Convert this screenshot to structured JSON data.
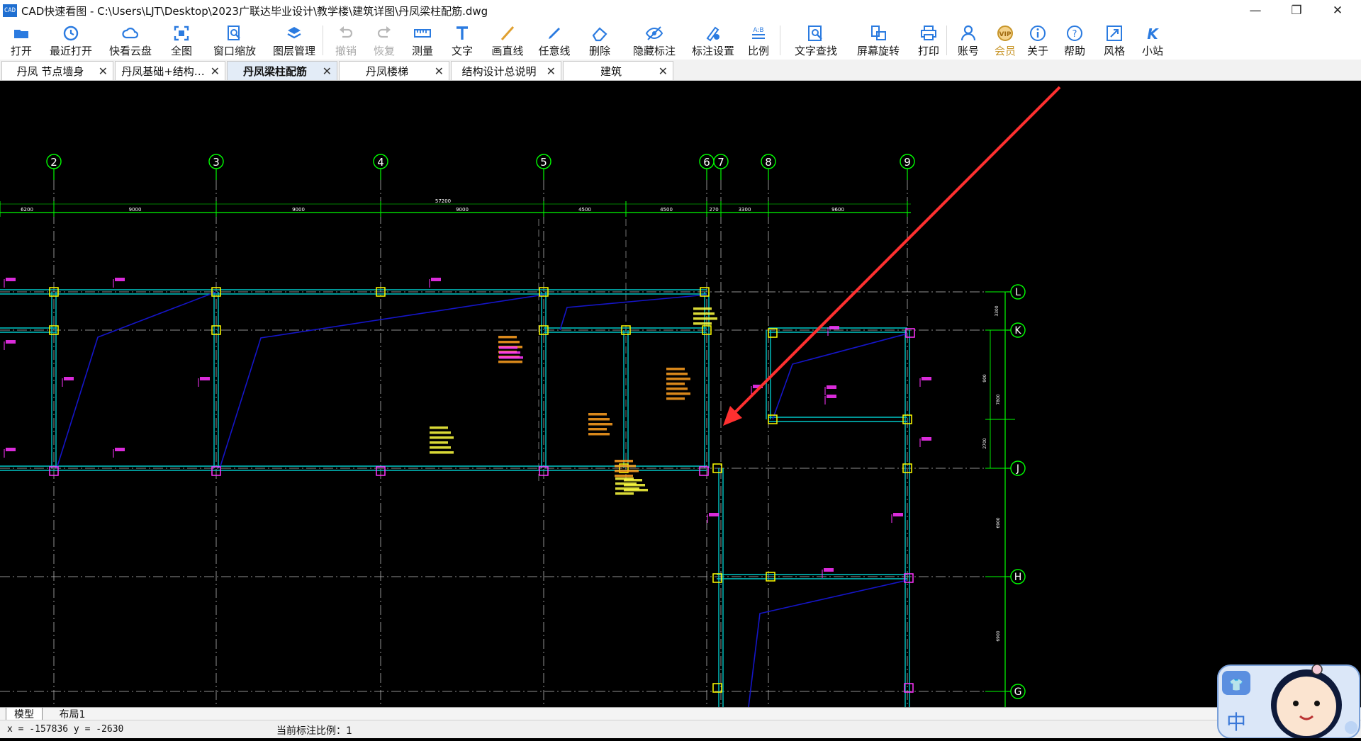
{
  "window": {
    "title": "CAD快速看图 - C:\\Users\\LJT\\Desktop\\2023广联达毕业设计\\教学楼\\建筑详图\\丹凤梁柱配筋.dwg",
    "icon_text": "CAD",
    "controls": {
      "minimize": "—",
      "restore": "❐",
      "close": "✕"
    }
  },
  "toolbar": {
    "items": [
      {
        "label": "打开",
        "icon": "folder-open-icon"
      },
      {
        "label": "最近打开",
        "icon": "history-icon"
      },
      {
        "label": "快看云盘",
        "icon": "cloud-icon"
      },
      {
        "label": "全图",
        "icon": "fullscreen-icon"
      },
      {
        "label": "窗口缩放",
        "icon": "zoom-window-icon"
      },
      {
        "label": "图层管理",
        "icon": "layers-icon"
      },
      {
        "label": "撤销",
        "icon": "undo-icon",
        "disabled": true
      },
      {
        "label": "恢复",
        "icon": "redo-icon",
        "disabled": true
      },
      {
        "label": "测量",
        "icon": "ruler-icon"
      },
      {
        "label": "文字",
        "icon": "text-icon"
      },
      {
        "label": "画直线",
        "icon": "line-icon"
      },
      {
        "label": "任意线",
        "icon": "pencil-icon"
      },
      {
        "label": "删除",
        "icon": "eraser-icon"
      },
      {
        "label": "隐藏标注",
        "icon": "eye-icon"
      },
      {
        "label": "标注设置",
        "icon": "annotation-settings-icon"
      },
      {
        "label": "比例",
        "icon": "scale-icon"
      },
      {
        "label": "文字查找",
        "icon": "text-search-icon"
      },
      {
        "label": "屏幕旋转",
        "icon": "rotate-screen-icon"
      },
      {
        "label": "打印",
        "icon": "printer-icon"
      },
      {
        "label": "账号",
        "icon": "user-icon"
      },
      {
        "label": "会员",
        "icon": "vip-icon",
        "vip": true
      },
      {
        "label": "关于",
        "icon": "info-icon"
      },
      {
        "label": "帮助",
        "icon": "help-icon"
      },
      {
        "label": "风格",
        "icon": "style-icon"
      },
      {
        "label": "小站",
        "icon": "k-station-icon"
      }
    ]
  },
  "tabs": [
    {
      "label": "丹凤 节点墙身",
      "active": false
    },
    {
      "label": "丹凤基础+结构…",
      "active": false
    },
    {
      "label": "丹凤梁柱配筋",
      "active": true
    },
    {
      "label": "丹凤楼梯",
      "active": false
    },
    {
      "label": "结构设计总说明",
      "active": false
    },
    {
      "label": "建筑",
      "active": false
    }
  ],
  "tab_close": "✕",
  "drawing": {
    "grid_axes_x": [
      "2",
      "3",
      "4",
      "5",
      "6",
      "7",
      "8",
      "9"
    ],
    "grid_axes_y": [
      "L",
      "K",
      "J",
      "H",
      "G"
    ],
    "dim_total": "57200",
    "dims_top": [
      "6200",
      "9000",
      "9000",
      "9000",
      "4500",
      "4500",
      "270",
      "3300",
      "9600"
    ],
    "dims_right": [
      "3300",
      "900",
      "7800",
      "2700",
      "6900",
      "6900"
    ],
    "colors": {
      "axis": "#00ff00",
      "beam": "#00c8c8",
      "column": "#ffff00",
      "annotation_magenta": "#ff33ff",
      "annotation_yellow": "#ffff40",
      "diagonal": "#1515c8",
      "gridline": "#bfbfbf",
      "arrow": "#ff3030"
    }
  },
  "layout_tabs": {
    "model": "模型",
    "layout1": "布局1"
  },
  "status": {
    "coords": "x = -157836 y = -2630",
    "scale_text": "当前标注比例：1"
  },
  "ime_widget": {
    "char": "中"
  }
}
